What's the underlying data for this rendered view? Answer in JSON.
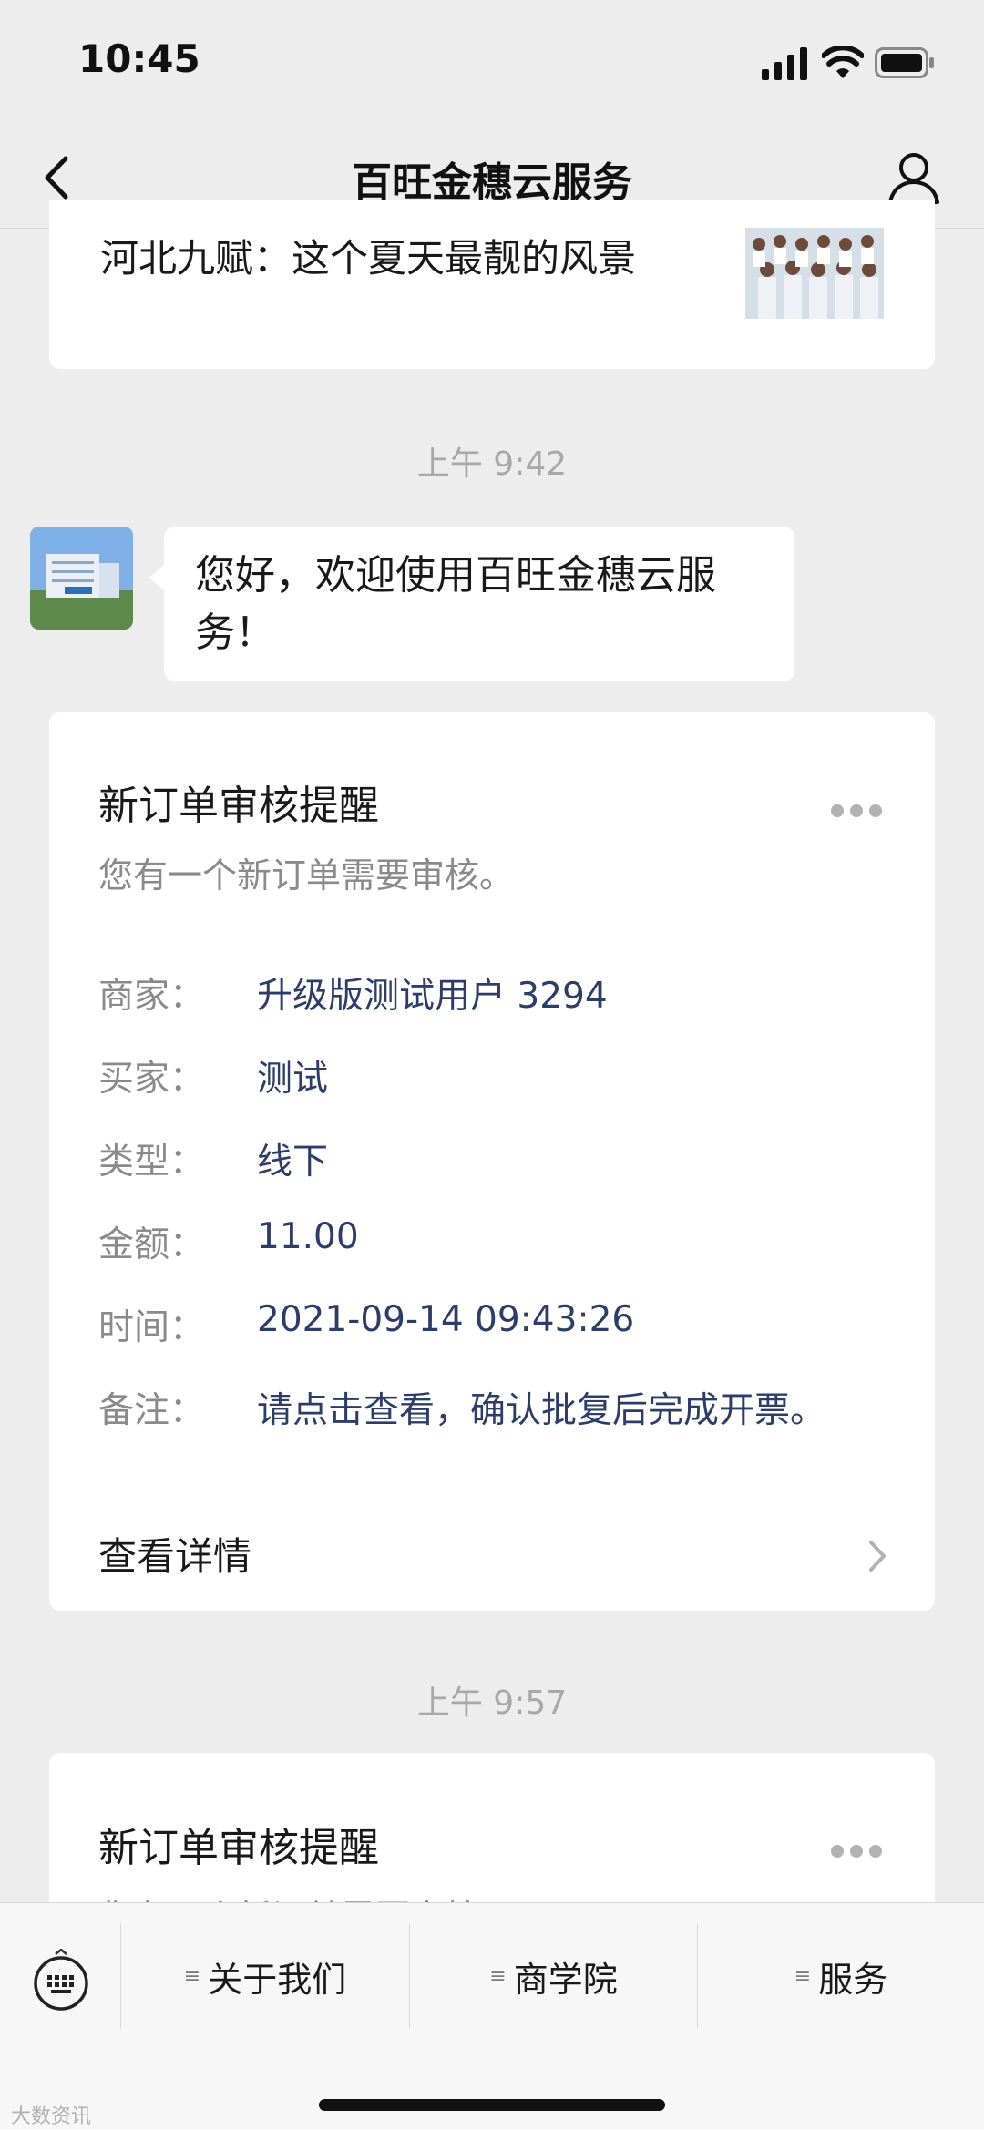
{
  "status_bar": {
    "time": "10:45"
  },
  "header": {
    "title": "百旺金穗云服务"
  },
  "article": {
    "title": "河北九赋：这个夏天最靓的风景"
  },
  "timestamps": [
    "上午 9:42",
    "上午 9:57"
  ],
  "welcome_message": "您好，欢迎使用百旺金穗云服务！",
  "notification": {
    "title": "新订单审核提醒",
    "subtitle": "您有一个新订单需要审核。",
    "rows": [
      {
        "label": "商家：",
        "value": "升级版测试用户 3294"
      },
      {
        "label": "买家：",
        "value": "测试"
      },
      {
        "label": "类型：",
        "value": "线下"
      },
      {
        "label": "金额：",
        "value": "11.00"
      },
      {
        "label": "时间：",
        "value": "2021-09-14 09:43:26"
      },
      {
        "label": "备注：",
        "value": "请点击查看，确认批复后完成开票。"
      }
    ],
    "detail_link": "查看详情"
  },
  "notification2": {
    "title": "新订单审核提醒",
    "subtitle": "您有一个新订单需要审核。"
  },
  "bottom_menu": {
    "items": [
      "关于我们",
      "商学院",
      "服务"
    ]
  },
  "watermark": "大数资讯",
  "colors": {
    "background": "#ededed",
    "value_text": "#2c3d6a",
    "label_text": "#8a8a8a"
  }
}
